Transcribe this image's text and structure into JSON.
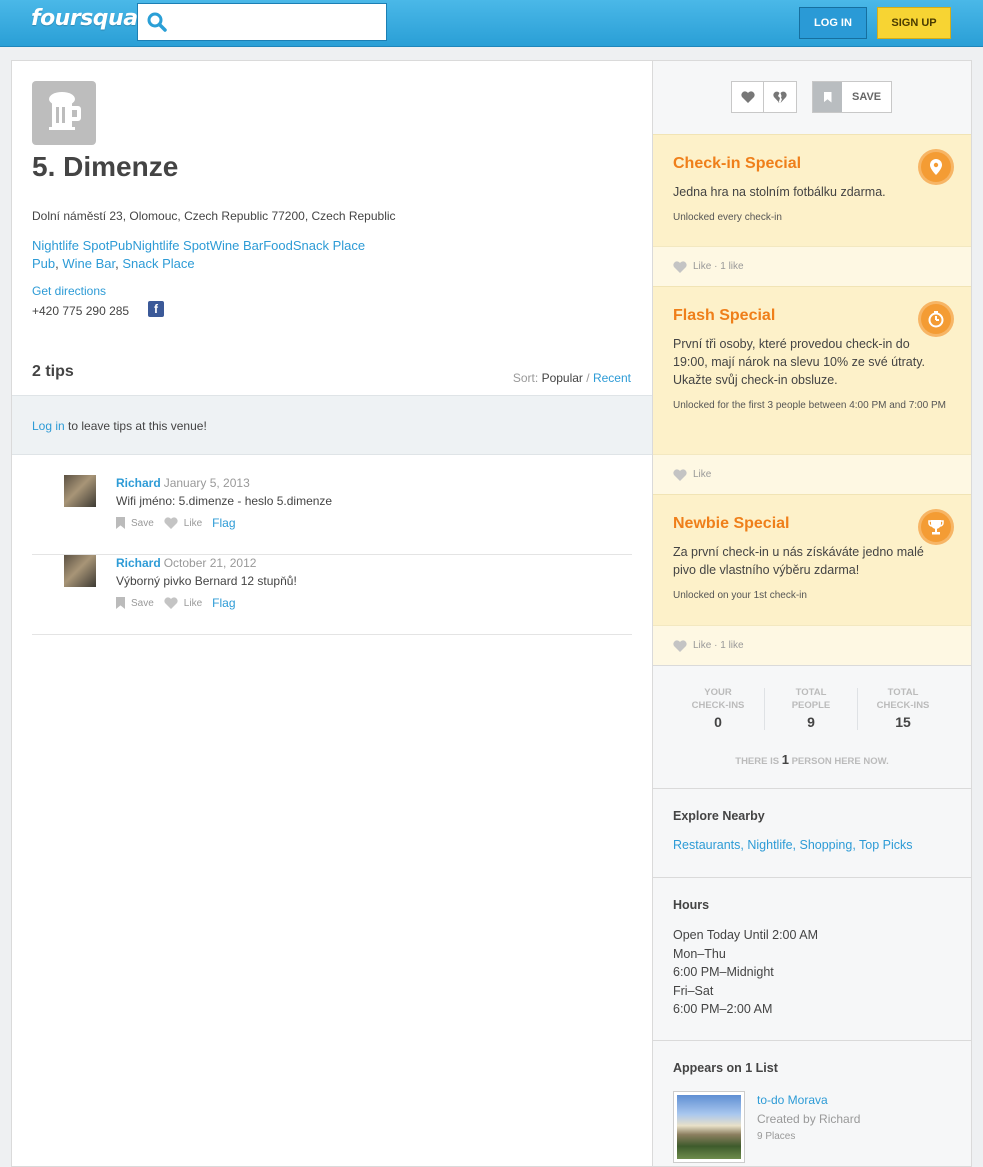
{
  "header": {
    "logo": "foursquare",
    "search_placeholder": "",
    "login_label": "LOG IN",
    "signup_label": "SIGN UP"
  },
  "venue": {
    "name": "5. Dimenze",
    "address": "Dolní náměstí 23, Olomouc, Czech Republic 77200, Czech Republic",
    "categories_line1": "Nightlife SpotPubNightlife SpotWine BarFoodSnack Place",
    "categories_line2": [
      "Pub",
      "Wine Bar",
      "Snack Place"
    ],
    "directions": "Get directions",
    "phone": "+420 775 290 285",
    "facebook_glyph": "f"
  },
  "tips": {
    "heading": "2 tips",
    "sort_label": "Sort:",
    "sort_popular": "Popular",
    "sort_sep": "/",
    "sort_recent": "Recent",
    "login_link": "Log in",
    "login_text": " to leave tips at this venue!",
    "save_label": "Save",
    "like_label": "Like",
    "flag_label": "Flag",
    "items": [
      {
        "author": "Richard",
        "date": "January 5, 2013",
        "text": "Wifi jméno: 5.dimenze - heslo 5.dimenze"
      },
      {
        "author": "Richard",
        "date": "October 21, 2012",
        "text": "Výborný pivko Bernard 12 stupňů!"
      }
    ]
  },
  "sidebar": {
    "save_label": "SAVE",
    "specials": [
      {
        "title": "Check-in Special",
        "description": "Jedna hra na stolním fotbálku zdarma.",
        "unlock": "Unlocked every check-in",
        "footer": "Like · 1 like",
        "icon": "map-pin-icon"
      },
      {
        "title": "Flash Special",
        "description": "První tři osoby, které provedou check-in do 19:00, mají nárok na slevu 10% ze své útraty. Ukažte svůj check-in obsluze.",
        "unlock": "Unlocked for the first 3 people between 4:00 PM and 7:00 PM",
        "footer": "Like",
        "icon": "clock-icon"
      },
      {
        "title": "Newbie Special",
        "description": "Za první check-in u nás získáváte jedno malé pivo dle vlastního výběru zdarma!",
        "unlock": "Unlocked on your 1st check-in",
        "footer": "Like · 1 like",
        "icon": "trophy-icon"
      }
    ],
    "stats": {
      "your_checkins_label_1": "YOUR",
      "your_checkins_label_2": "CHECK-INS",
      "your_checkins": "0",
      "total_people_label_1": "TOTAL",
      "total_people_label_2": "PEOPLE",
      "total_people": "9",
      "total_checkins_label_1": "TOTAL",
      "total_checkins_label_2": "CHECK-INS",
      "total_checkins": "15",
      "here_now_pre": "THERE IS ",
      "here_now_count": "1",
      "here_now_post": " PERSON HERE NOW."
    },
    "explore": {
      "heading": "Explore Nearby",
      "links": [
        "Restaurants",
        "Nightlife",
        "Shopping",
        "Top Picks"
      ]
    },
    "hours": {
      "heading": "Hours",
      "lines": [
        "Open Today Until 2:00 AM",
        "Mon–Thu",
        "6:00 PM–Midnight",
        "Fri–Sat",
        "6:00 PM–2:00 AM"
      ]
    },
    "lists": {
      "heading": "Appears on 1 List",
      "name": "to-do Morava",
      "creator": "Created by Richard",
      "count": "9 Places"
    }
  },
  "colors": {
    "header_blue": "#2a9fd6",
    "signup_yellow": "#f7d433",
    "special_bg": "#fdf1c9",
    "special_title": "#ef7f1a",
    "link": "#2d9bd6"
  }
}
